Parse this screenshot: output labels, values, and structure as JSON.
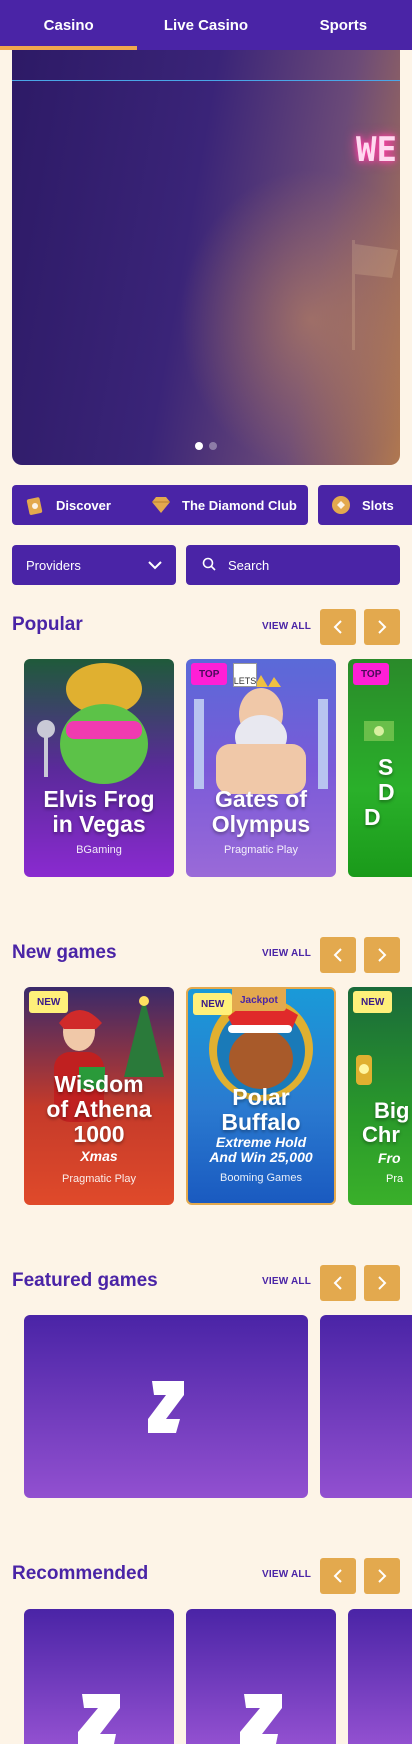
{
  "nav": {
    "tabs": [
      {
        "label": "Casino",
        "active": true
      },
      {
        "label": "Live Casino"
      },
      {
        "label": "Sports"
      }
    ]
  },
  "hero": {
    "title": "WE",
    "slides": 2,
    "active_slide": 1
  },
  "categories": [
    {
      "label": "Discover",
      "icon": "discover-icon"
    },
    {
      "label": "The Diamond Club",
      "icon": "diamond-icon"
    },
    {
      "label": "Slots",
      "icon": "slots-icon"
    }
  ],
  "filters": {
    "providers_label": "Providers",
    "search_placeholder": "Search"
  },
  "sections": {
    "popular": {
      "title": "Popular",
      "view_all": "VIEW ALL",
      "games": [
        {
          "name": "Elvis Frog in Vegas",
          "line1": "Elvis Frog",
          "line2": "in Vegas",
          "provider": "BGaming",
          "badge": ""
        },
        {
          "name": "Gates of Olympus",
          "line1": "Gates of",
          "line2": "Olympus",
          "provider": "Pragmatic Play",
          "badge": "TOP",
          "broken_image_alt": "LETS"
        },
        {
          "name": "Sweet Dollar",
          "line1": "S",
          "line2": "D",
          "line3": "D",
          "provider": "",
          "badge": "TOP"
        }
      ]
    },
    "new_games": {
      "title": "New games",
      "view_all": "VIEW ALL",
      "games": [
        {
          "line1": "Wisdom",
          "line2": "of Athena",
          "line3": "1000",
          "subtitle": "Xmas",
          "provider": "Pragmatic Play",
          "badge": "NEW"
        },
        {
          "line1": "Polar",
          "line2": "Buffalo",
          "subtitle1": "Extreme Hold",
          "subtitle2": "And Win 25,000",
          "provider": "Booming Games",
          "badge": "NEW",
          "badge2": "Jackpot"
        },
        {
          "line1": "Big",
          "line2": "Chr",
          "subtitle": "Fro",
          "provider": "Pra",
          "badge": "NEW"
        }
      ]
    },
    "featured": {
      "title": "Featured games",
      "view_all": "VIEW ALL"
    },
    "recommended": {
      "title": "Recommended",
      "view_all": "VIEW ALL"
    }
  },
  "colors": {
    "brand": "#4a24a6",
    "accent": "#e3a94e",
    "background": "#fdf4e7",
    "top_badge": "#ff1fd6",
    "new_badge": "#fff07a"
  }
}
